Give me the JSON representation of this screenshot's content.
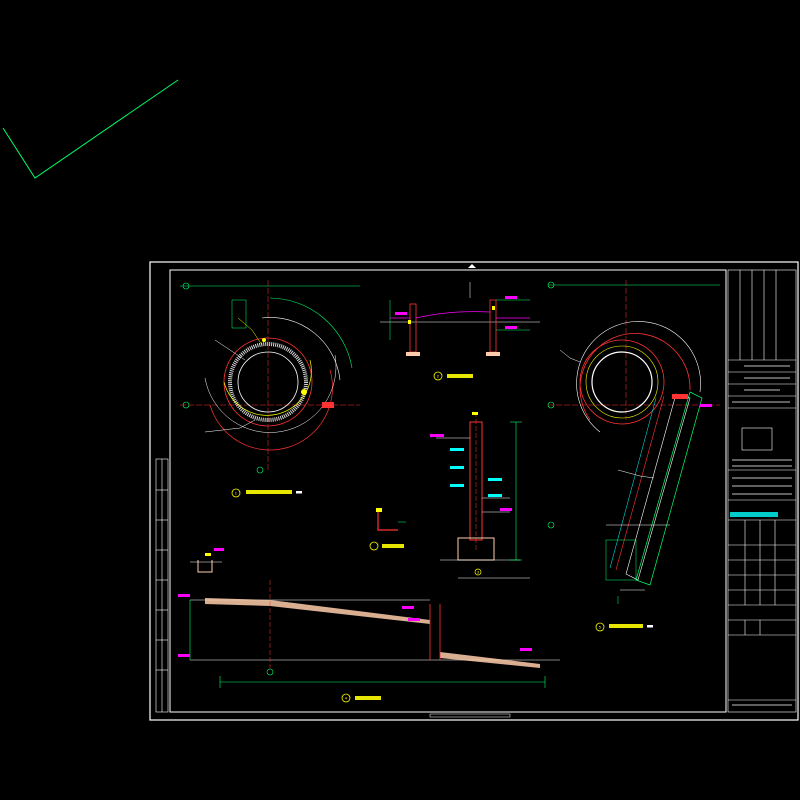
{
  "colors": {
    "background": "#000000",
    "frame": "#ffffff",
    "outline": "#ff3333",
    "dimension": "#00ff66",
    "centerline": "#ff3333",
    "leader": "#ffff00",
    "tag": "#ff00ff",
    "slab": "#ffccaa",
    "hatch": "#00ffff",
    "title_text": "#ffff00"
  },
  "icons": {
    "section_bubble": "circled-number-icon",
    "elevation_tag": "magenta-elevation-tag-icon",
    "north_arrow": "triangle-marker-icon"
  },
  "drawing": {
    "view_numbers": [
      "1",
      "2",
      "3",
      "4",
      "5"
    ]
  }
}
